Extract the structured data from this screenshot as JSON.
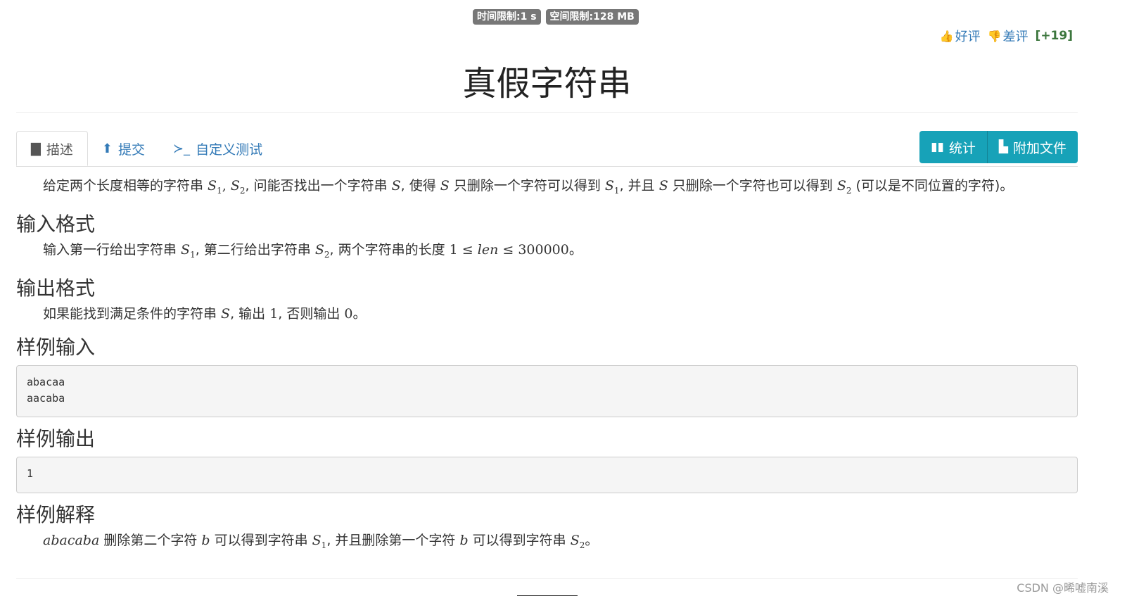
{
  "limits": {
    "time": "时间限制:1 s",
    "memory": "空间限制:128 MB"
  },
  "rating": {
    "good_icon": "thumbs-up-icon",
    "good": "好评",
    "bad_icon": "thumbs-down-icon",
    "bad": "差评",
    "score": "[+19]"
  },
  "title": "真假字符串",
  "tabs": [
    {
      "icon": "book-icon",
      "label": "描述",
      "active": true
    },
    {
      "icon": "upload-circle-icon",
      "label": "提交",
      "active": false
    },
    {
      "icon": "terminal-icon",
      "label": "自定义测试",
      "active": false
    }
  ],
  "buttons": {
    "stats": "统计",
    "files": "附加文件"
  },
  "description": {
    "t1": "给定两个长度相等的字符串 ",
    "t2": ", 问能否找出一个字符串 ",
    "t3": ", 使得 ",
    "t4": " 只删除一个字符可以得到 ",
    "t5": ", 并且 ",
    "t6": " 只删除一个字符也可以得到 ",
    "t7": " (可以是不同位置的字符)。"
  },
  "input_format": {
    "heading": "输入格式",
    "t1": "输入第一行给出字符串 ",
    "t2": ", 第二行给出字符串 ",
    "t3": ", 两个字符串的长度 ",
    "len": "len",
    "upper": "300000",
    "t4": "。"
  },
  "output_format": {
    "heading": "输出格式",
    "t1": "如果能找到满足条件的字符串 ",
    "t2": ", 输出 ",
    "one": "1",
    "t3": ", 否则输出 ",
    "zero": "0",
    "t4": "。"
  },
  "sample_input": {
    "heading": "样例输入",
    "lines": [
      "abacaa",
      "aacaba"
    ]
  },
  "sample_output": {
    "heading": "样例输出",
    "lines": [
      "1"
    ]
  },
  "explanation": {
    "heading": "样例解释",
    "word": "abacaba",
    "t1": " 删除第二个字符 ",
    "b": "b",
    "t2": " 可以得到字符串 ",
    "t3": ", 并且删除第一个字符 ",
    "t4": " 可以得到字符串 ",
    "t5": "。"
  },
  "math": {
    "S": "S",
    "sub1": "1",
    "sub2": "2",
    "one": "1",
    "le": "≤"
  },
  "watermark": "CSDN @晞嘘南溪"
}
